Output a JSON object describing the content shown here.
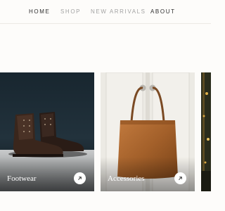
{
  "nav": {
    "items": [
      {
        "label": "HOME"
      },
      {
        "label": "SHOP"
      },
      {
        "label": "NEW ARRIVALS"
      },
      {
        "label": "ABOUT"
      }
    ]
  },
  "categories": [
    {
      "label": "Footwear",
      "icon": "arrow-up-right-icon"
    },
    {
      "label": "Accessories",
      "icon": "arrow-up-right-icon"
    }
  ],
  "colors": {
    "nav_text_dark": "#2d2d2d",
    "nav_text_muted": "#a3a3a3",
    "page_background": "#fdfcfa",
    "card_label": "#ffffff"
  }
}
